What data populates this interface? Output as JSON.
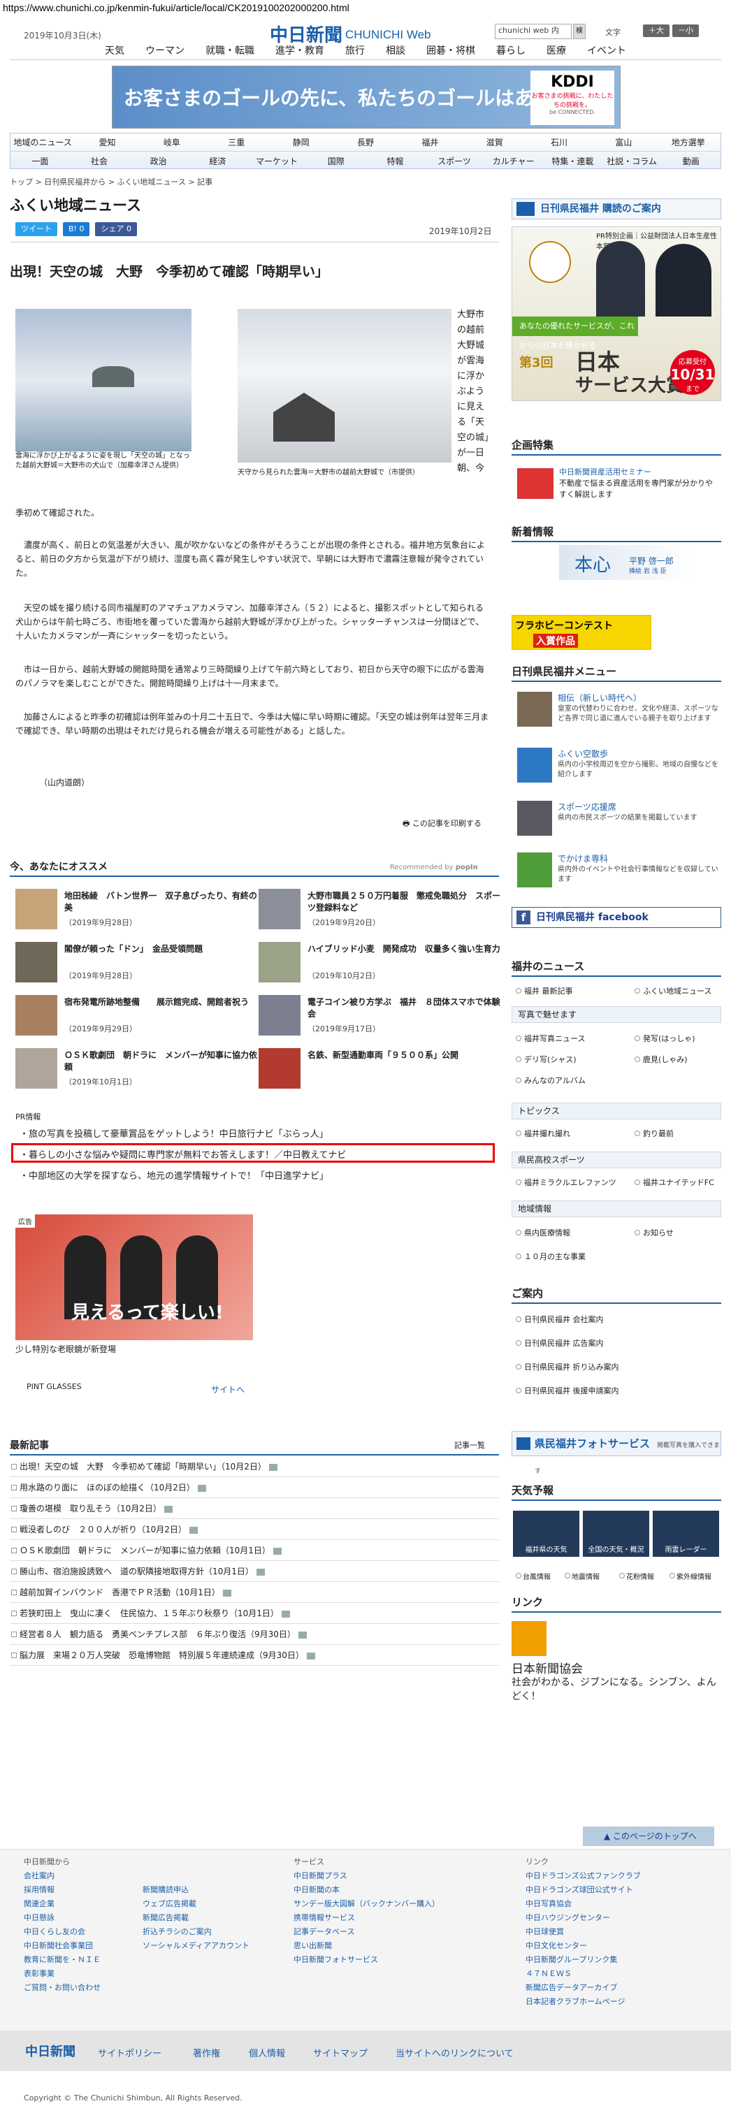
{
  "url": "https://www.chunichi.co.jp/kenmin-fukui/article/local/CK2019100202000200.html",
  "header": {
    "date": "2019年10月3日(木)",
    "logo": "中日新聞",
    "logo_en": "CHUNICHI Web",
    "search_placeholder": "chunichi web 内",
    "search_btn": "検",
    "textsize_label": "文字",
    "bigger": "＋大",
    "smaller": "－小"
  },
  "topnav": [
    "天気",
    "ウーマン",
    "就職・転職",
    "進学・教育",
    "旅行",
    "相談",
    "囲碁・将棋",
    "暮らし",
    "医療",
    "イベント"
  ],
  "ad1": {
    "text": "お客さまのゴールの先に、私たちのゴールはある。",
    "brand": "KDDI",
    "brand_sub": "お客さまの挑戦に、わたしたちの挑戦を。",
    "brand_sub2": "be CONNECTED."
  },
  "nav2": {
    "row1": [
      "地域のニュース",
      "愛知",
      "岐阜",
      "三重",
      "静岡",
      "長野",
      "福井",
      "滋賀",
      "石川",
      "富山",
      "地方選挙"
    ],
    "row2": [
      "一面",
      "社会",
      "政治",
      "経済",
      "マーケット",
      "国際",
      "特報",
      "スポーツ",
      "カルチャー",
      "特集・連載",
      "社説・コラム",
      "動画"
    ]
  },
  "breadcrumb": "トップ > 日刊県民福井から > ふくい地域ニュース > 記事",
  "page_title": "ふくい地域ニュース",
  "social": {
    "tweet": "ツイート",
    "hatena": "B! 0",
    "share": "シェア 0"
  },
  "article": {
    "date": "2019年10月2日",
    "title": "出現！天空の城　大野　今季初めて確認「時期早い」",
    "caption1": "雲海に浮かび上がるように姿を現し「天空の城」となった越前大野城＝大野市の犬山で（加藤幸洋さん提供）",
    "caption2": "天守から見られた雲海＝大野市の越前大野城で（市提供）",
    "side_text": "大野市の越前大野城が雲海に浮かぶように見える「天空の城」が一日朝、今",
    "lead": "季初めて確認された。",
    "p1": "　濃度が高く、前日との気温差が大きい、風が吹かないなどの条件がそろうことが出現の条件とされる。福井地方気象台によると、前日の夕方から気温が下がり続け、湿度も高く霧が発生しやすい状況で、早朝には大野市で濃霧注意報が発令されていた。",
    "p2": "　天空の城を撮り続ける同市福屋町のアマチュアカメラマン、加藤幸洋さん（５２）によると、撮影スポットとして知られる犬山からは午前七時ごろ、市街地を覆っていた雲海から越前大野城が浮かび上がった。シャッターチャンスは一分間ほどで、十人いたカメラマンが一斉にシャッターを切ったという。",
    "p3": "　市は一日から、越前大野城の開館時間を通常より三時間繰り上げて午前六時としており、初日から天守の眼下に広がる雲海のパノラマを楽しむことができた。開館時間繰り上げは十一月末まで。",
    "p4": "　加藤さんによると昨季の初確認は例年並みの十月二十五日で、今季は大幅に早い時期に確認。「天空の城は例年は翌年三月まで確認でき、早い時期の出現はそれだけ見られる機会が増える可能性がある」と話した。",
    "author": "（山内道朗）",
    "print": "この記事を印刷する"
  },
  "recommend": {
    "title": "今、あなたにオススメ",
    "by": "Recommended by",
    "popin": "popIn",
    "items": [
      {
        "title": "地田秭綾　バトン世界一　双子息ぴったり、有終の美",
        "date": "（2019年9月28日）"
      },
      {
        "title": "大野市職員２５０万円着服　懲戒免職処分　スポーツ登録料など",
        "date": "（2019年9月20日）"
      },
      {
        "title": "閣僚が頼った「ドン」　金品受領問題",
        "date": "（2019年9月28日）"
      },
      {
        "title": "ハイブリッド小麦　開発成功　収量多く強い生育力",
        "date": "（2019年10月2日）"
      },
      {
        "title": "宿布発電所跡地整備　　展示館完成、開館者祝う",
        "date": "（2019年9月29日）"
      },
      {
        "title": "電子コイン被り方学ぶ　福井　８団体スマホで体験会",
        "date": "（2019年9月17日）"
      },
      {
        "title": "ＯＳＫ歌劇団　朝ドラに　メンバーが知事に協力依頼",
        "date": "（2019年10月1日）"
      },
      {
        "title": "名鉄、新型通勤車両「９５００系」公開",
        "date": ""
      }
    ]
  },
  "pr": {
    "label": "PR情報",
    "items": [
      "旅の写真を投稿して豪華賞品をゲットしよう！中日旅行ナビ「ぶらっ人」",
      "暮らしの小さな悩みや疑問に専門家が無料でお答えします！／中日教えてナビ",
      "中部地区の大学を探すなら、地元の進学情報サイトで！「中日進学ナビ」"
    ]
  },
  "ad2": {
    "label": "広告",
    "text": "見えるって楽しい!",
    "caption": "少し特別な老眼鏡が新登場",
    "brand": "PINT GLASSES",
    "site": "サイトへ"
  },
  "latest": {
    "title": "最新記事",
    "more": "記事一覧",
    "items": [
      "出現！天空の城　大野　今季初めて確認「時期早い」（10月2日）",
      "用水路のり面に　ほのぼの絵描く（10月2日）",
      "瓊善の堪模　取り乱そう（10月2日）",
      "戦没者しのび　２００人が祈り（10月2日）",
      "ＯＳＫ歌劇団　朝ドラに　メンバーが知事に協力依頼（10月1日）",
      "勝山市、宿泊施設誘致へ　道の駅隣接地取得方針（10月1日）",
      "越前加賀インバウンド　香港でＰＲ活動（10月1日）",
      "若狭町田上　曳山に凄く　住民協力、１５年ぶり秋祭り（10月1日）",
      "経営者８人　観力語る　勇美ベンチプレス部　６年ぶり復活（9月30日）",
      "脳力展　来場２０万人突破　恐竜博物館　特別展５年連続達成（9月30日）"
    ]
  },
  "right": {
    "subscribe": "日刊県民福井 購読のご案内",
    "award": {
      "top": "PR特別企画｜公益財団法人日本生産性本部",
      "stripe": "あなたの優れたサービスが、これからの日本を輝かせる",
      "no": "第3回",
      "t1": "日本",
      "t2": "サービス大賞",
      "dl1": "応募受付",
      "dl2": "10/31",
      "dl3": "まで"
    },
    "kikaku": {
      "title": "企画特集",
      "item_title": "中日新聞資産活用セミナー",
      "item_desc": "不動産で悩まる資産活用を専門家が分かりやすく解説します"
    },
    "shinkan": {
      "title": "新着情報",
      "book": "本心",
      "author": "平野 啓一郎",
      "sub": "挿絵 岩 浅 臣"
    },
    "hula": {
      "a": "フラホビーコンテスト",
      "b": "入賞作品"
    },
    "menu": {
      "title": "日刊県民福井メニュー",
      "items": [
        {
          "t": "相伝（新しい時代へ）",
          "d": "皇室の代替わりに合わせ、文化や経済、スポーツなど各界で同じ道に進んでいる親子を取り上げます"
        },
        {
          "t": "ふくい空散歩",
          "d": "県内の小学校周辺を空から撮影。地域の自慢などを紹介します"
        },
        {
          "t": "スポーツ応援席",
          "d": "県内の市民スポーツの結果を掲載しています"
        },
        {
          "t": "でかけま専科",
          "d": "県内外のイベントや社会行事情報などを収録しています"
        }
      ]
    },
    "facebook": "日刊県民福井 facebook",
    "fukui_news": {
      "title": "福井のニュース",
      "l1": "福井 最新記事",
      "l2": "ふくい地域ニュース"
    },
    "photo_head": "写真で魅せます",
    "photo_links": [
      "福井写真ニュース",
      "発写(はっしゃ)",
      "デリ写(シャス)",
      "鹿見(しゃみ)",
      "みんなのアルバム"
    ],
    "topics_head": "トピックス",
    "topics_links": [
      "福井撮れ撮れ",
      "釣り最前"
    ],
    "sports_head": "県民高校スポーツ",
    "sports_links": [
      "福井ミラクルエレファンツ",
      "福井ユナイテッドFC"
    ],
    "area_head": "地域情報",
    "area_links": [
      "県内医療情報",
      "お知らせ",
      "１０月の主な事業"
    ],
    "guide": {
      "title": "ご案内",
      "items": [
        "日刊県民福井 会社案内",
        "日刊県民福井 広告案内",
        "日刊県民福井 折り込み案内",
        "日刊県民福井 後援申請案内"
      ]
    },
    "photo_svc": "県民福井フォトサービス",
    "photo_svc_sub": "掲載写真を購入できます",
    "weather": {
      "title": "天気予報",
      "boxes": [
        "福井県の天気",
        "全国の天気・概況",
        "雨雲レーダー"
      ],
      "links": [
        "台風情報",
        "地震情報",
        "花粉情報",
        "紫外線情報"
      ]
    },
    "link": {
      "title": "リンク",
      "name": "日本新聞協会",
      "desc": "社会がわかる、ジブンになる。シンブン、よんどく！"
    }
  },
  "pagetop": "このページのトップへ",
  "footer": {
    "col1_head": "中日新聞から",
    "col1": [
      "会社案内",
      "採用情報",
      "関連企業",
      "中日懸詠",
      "中日くらし友の会",
      "中日新聞社会事業団",
      "教育に新聞を・ＮＩＥ",
      "表彰事業",
      "ご質問・お問い合わせ"
    ],
    "col2": [
      "新聞購読申込",
      "ウェブ広告掲載",
      "新聞広告掲載",
      "折込チラシのご案内",
      "ソーシャルメディアアカウント"
    ],
    "col3_head": "サービス",
    "col3": [
      "中日新聞プラス",
      "中日新聞の本",
      "サンデー版大図解（バックナンバー購入）",
      "携帯情報サービス",
      "記事データベース",
      "思い出新聞",
      "中日新聞フォトサービス"
    ],
    "col4_head": "リンク",
    "col4": [
      "中日ドラゴンズ公式ファンクラブ",
      "中日ドラゴンズ球団公式サイト",
      "中日写真協会",
      "中日ハウジングセンター",
      "中日球使賞",
      "中日文化センター",
      "中日新聞グループリンク集",
      "４７ＮＥＷＳ",
      "新聞広告データアーカイブ",
      "日本記者クラブホームページ"
    ],
    "logo": "中日新聞",
    "links": [
      "サイトポリシー",
      "著作権",
      "個人情報",
      "サイトマップ",
      "当サイトへのリンクについて"
    ],
    "copyright": "Copyright © The Chunichi Shimbun, All Rights Reserved."
  }
}
